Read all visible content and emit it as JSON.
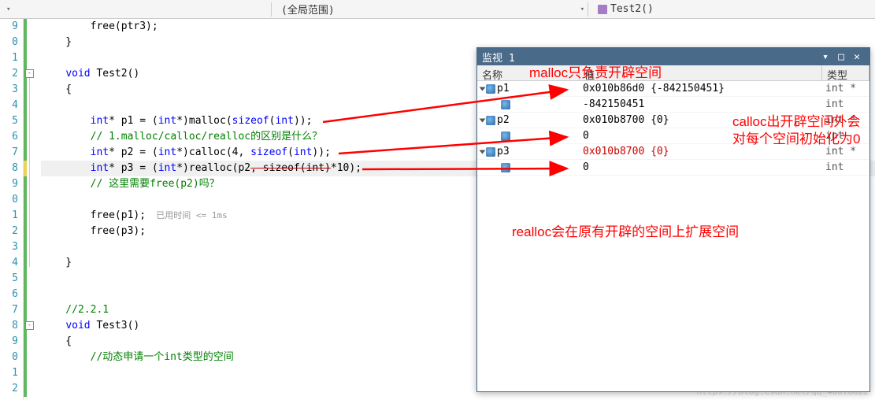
{
  "toolbar": {
    "scope": "(全局范围)",
    "func": "Test2()"
  },
  "gutter": [
    "9",
    "0",
    "1",
    "2",
    "3",
    "4",
    "5",
    "6",
    "7",
    "8",
    "9",
    "0",
    "1",
    "2",
    "3",
    "4",
    "5",
    "6",
    "7",
    "8",
    "9",
    "0",
    "1",
    "2"
  ],
  "code": {
    "l1_a": "        free(ptr3);",
    "l2": "    }",
    "l3": "",
    "l4_kw": "void",
    "l4_fn": " Test2()",
    "l5": "    {",
    "l6": "",
    "l7_a": "        ",
    "l7_kw1": "int",
    "l7_b": "* p1 = (",
    "l7_kw2": "int",
    "l7_c": "*)malloc(",
    "l7_kw3": "sizeof",
    "l7_d": "(",
    "l7_kw4": "int",
    "l7_e": "));",
    "l8": "        // 1.malloc/calloc/realloc的区别是什么？",
    "l9_a": "        ",
    "l9_kw1": "int",
    "l9_b": "* p2 = (",
    "l9_kw2": "int",
    "l9_c": "*)calloc(4, ",
    "l9_kw3": "sizeof",
    "l9_d": "(",
    "l9_kw4": "int",
    "l9_e": "));",
    "l10_a": "        ",
    "l10_kw1": "int",
    "l10_b": "* p3 = (",
    "l10_kw2": "int",
    "l10_c": "*)realloc(p2",
    "l10_s": ", sizeof(int)",
    "l10_d": "*10);",
    "l11": "        // 这里需要free(p2)吗？",
    "l12": "",
    "l13_a": "        free(p1);",
    "l13_h": "  已用时间 <= 1ms",
    "l14": "        free(p3);",
    "l15": "",
    "l16": "    }",
    "l17": "",
    "l18": "",
    "l19": "    //2.2.1",
    "l20_kw": "void",
    "l20_fn": " Test3()",
    "l21": "    {",
    "l22": "        //动态申请一个int类型的空间"
  },
  "watch": {
    "title": "监视 1",
    "headers": {
      "name": "名称",
      "value": "值",
      "type": "类型"
    },
    "rows": [
      {
        "exp": true,
        "icon": true,
        "name": "p1",
        "value": "0x010b86d0 {-842150451}",
        "type": "int *"
      },
      {
        "exp": false,
        "indent": true,
        "icon": true,
        "name": "",
        "value": "-842150451",
        "type": "int"
      },
      {
        "exp": true,
        "icon": true,
        "name": "p2",
        "value": "0x010b8700 {0}",
        "type": "int *"
      },
      {
        "exp": false,
        "indent": true,
        "icon": true,
        "name": "",
        "value": "0",
        "type": "int"
      },
      {
        "exp": true,
        "icon": true,
        "name": "p3",
        "value": "0x010b8700 {0}",
        "type": "int *",
        "red": true
      },
      {
        "exp": false,
        "indent": true,
        "icon": true,
        "name": "",
        "value": "0",
        "type": "int"
      }
    ]
  },
  "anno": {
    "a1": "malloc只负责开辟空间",
    "a2": "calloc出开辟空间外会",
    "a3": "对每个空间初始化为0",
    "a4": "realloc会在原有开辟的空间上扩展空间"
  },
  "watermark": "https://blog.csdn.net/qq_40076022"
}
